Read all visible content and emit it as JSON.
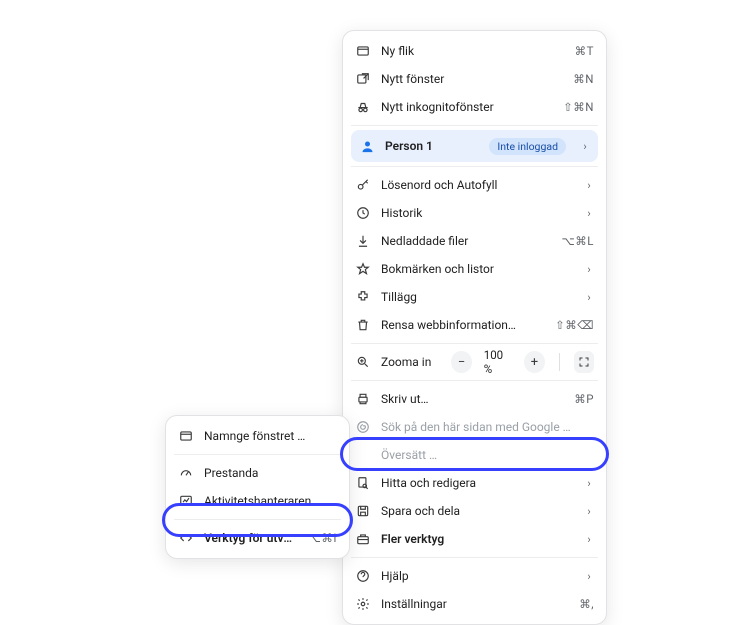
{
  "main_menu": {
    "new_tab": {
      "label": "Ny flik",
      "shortcut": "⌘T"
    },
    "new_window": {
      "label": "Nytt fönster",
      "shortcut": "⌘N"
    },
    "new_incognito": {
      "label": "Nytt inkognitofönster",
      "shortcut": "⇧⌘N"
    },
    "profile": {
      "label": "Person 1",
      "badge": "Inte inloggad"
    },
    "passwords": {
      "label": "Lösenord och Autofyll"
    },
    "history": {
      "label": "Historik"
    },
    "downloads": {
      "label": "Nedladdade filer",
      "shortcut": "⌥⌘L"
    },
    "bookmarks": {
      "label": "Bokmärken och listor"
    },
    "extensions": {
      "label": "Tillägg"
    },
    "clear_data": {
      "label": "Rensa webbinformation…",
      "shortcut": "⇧⌘⌫"
    },
    "zoom": {
      "label": "Zooma in",
      "value": "100 %"
    },
    "print": {
      "label": "Skriv ut…",
      "shortcut": "⌘P"
    },
    "search_google": {
      "label": "Sök på den här sidan med Google …"
    },
    "translate": {
      "label": "Översätt …"
    },
    "find_edit": {
      "label": "Hitta och redigera"
    },
    "save_share": {
      "label": "Spara och dela"
    },
    "more_tools": {
      "label": "Fler verktyg"
    },
    "help": {
      "label": "Hjälp"
    },
    "settings": {
      "label": "Inställningar",
      "shortcut": "⌘,"
    }
  },
  "sub_menu": {
    "name_window": {
      "label": "Namnge fönstret …"
    },
    "performance": {
      "label": "Prestanda"
    },
    "task_manager": {
      "label": "Aktivitetshanteraren …"
    },
    "dev_tools": {
      "label": "Verktyg för utvecklare",
      "shortcut": "⌥⌘I"
    }
  }
}
